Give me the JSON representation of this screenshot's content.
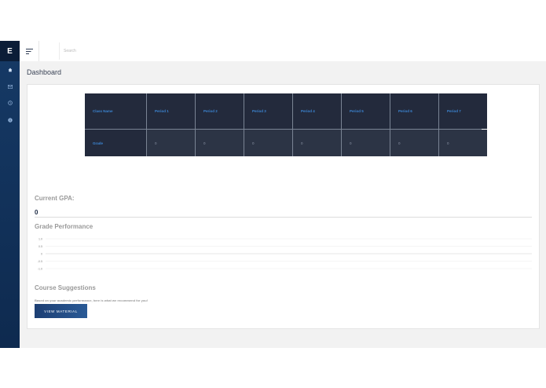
{
  "brand": {
    "letter": "E"
  },
  "nav": {
    "items": [
      {
        "icon": "home-icon"
      },
      {
        "icon": "mail-icon"
      },
      {
        "icon": "clock-icon"
      },
      {
        "icon": "info-icon"
      }
    ]
  },
  "topbar": {
    "menu_icon": "menu-icon",
    "search_placeholder": "Search"
  },
  "page": {
    "title": "Dashboard"
  },
  "grades_table": {
    "headers": [
      "Class Name",
      "Period 1",
      "Period 2",
      "Period 3",
      "Period 4",
      "Period 5",
      "Period 6",
      "Period 7"
    ],
    "row_label": "Grade",
    "values": [
      "0",
      "0",
      "0",
      "0",
      "0",
      "0",
      "0"
    ]
  },
  "gpa": {
    "label": "Current GPA:",
    "value": "0"
  },
  "performance": {
    "label": "Grade Performance"
  },
  "chart_data": {
    "type": "line",
    "title": "Grade Performance",
    "x": [],
    "series": [],
    "yticks": [
      "1.0",
      "0.5",
      "0",
      "-0.5",
      "-1.0"
    ],
    "ylim": [
      -1.0,
      1.0
    ],
    "grid": true
  },
  "suggestions": {
    "title": "Course Suggestions",
    "text": "Based on your academic performance, here is what we recommend for you!",
    "button": "VIEW MATERIAL"
  },
  "colors": {
    "sidebar": "#163a66",
    "table_bg": "#232a3c",
    "table_header_text": "#3c86d4",
    "button": "#1d3f73"
  }
}
